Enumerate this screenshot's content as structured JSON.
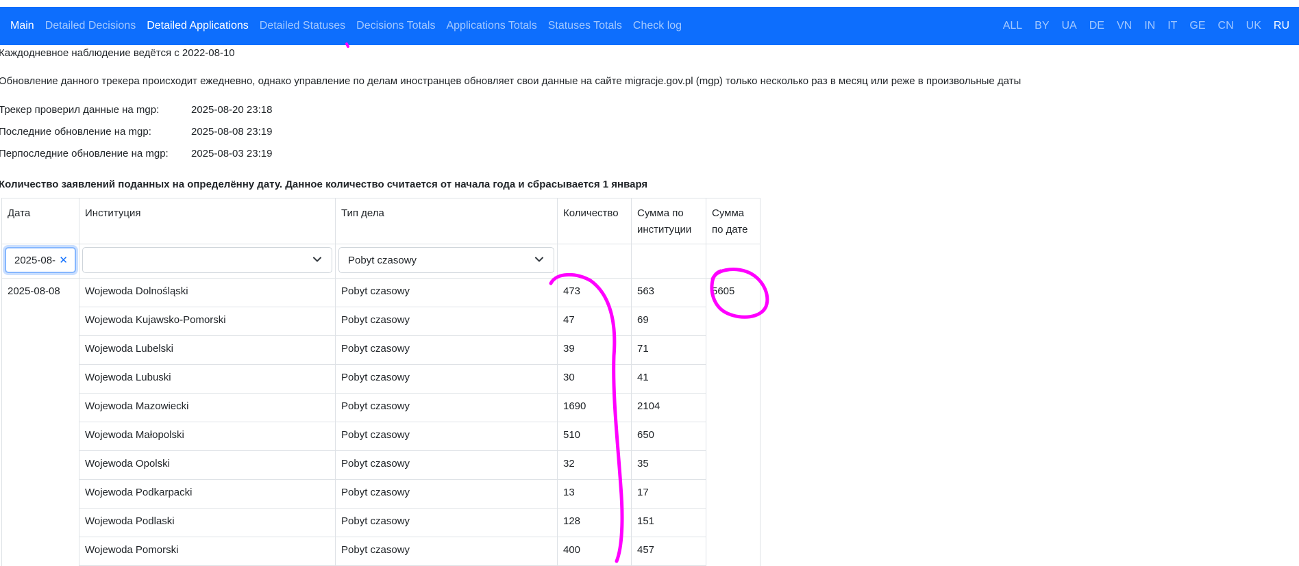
{
  "nav": {
    "left": [
      {
        "label": "Main",
        "active": true
      },
      {
        "label": "Detailed Decisions",
        "active": false
      },
      {
        "label": "Detailed Applications",
        "active": true
      },
      {
        "label": "Detailed Statuses",
        "active": false
      },
      {
        "label": "Decisions Totals",
        "active": false
      },
      {
        "label": "Applications Totals",
        "active": false
      },
      {
        "label": "Statuses Totals",
        "active": false
      },
      {
        "label": "Check log",
        "active": false
      }
    ],
    "langs": [
      "ALL",
      "BY",
      "UA",
      "DE",
      "VN",
      "IN",
      "IT",
      "GE",
      "CN",
      "UK",
      "RU"
    ],
    "active_lang": "RU"
  },
  "intro": {
    "since": "Каждодневное наблюдение ведётся с 2022-08-10",
    "note": "Обновление данного трекера происходит ежедневно, однако управление по делам иностранцев обновляет свои данные на сайте migracje.gov.pl (mgp) только несколько раз в месяц или реже в произвольные даты"
  },
  "info": [
    {
      "label": "Трекер проверил данные на mgp:",
      "value": "2025-08-20 23:18"
    },
    {
      "label": "Последние обновление на mgp:",
      "value": "2025-08-08 23:19"
    },
    {
      "label": "Перпоследние обновление на mgp:",
      "value": "2025-08-03 23:19"
    }
  ],
  "table_title": "Количество заявлений поданных на определённу дату. Данное количество считается от начала года и сбрасывается 1 января",
  "table": {
    "headers": [
      "Дата",
      "Институция",
      "Тип дела",
      "Количество",
      "Сумма по институции",
      "Сумма по дате"
    ],
    "header_lines": {
      "h4": [
        "Сумма по",
        "институции"
      ],
      "h5": [
        "Сумма",
        "по дате"
      ]
    },
    "filters": {
      "date_value": "2025-08-",
      "institution_value": "",
      "case_type_value": "Pobyt czasowy"
    },
    "date": "2025-08-08",
    "date_total": "5605",
    "rows": [
      {
        "institution": "Wojewoda Dolnośląski",
        "type": "Pobyt czasowy",
        "count": "473",
        "sum": "563"
      },
      {
        "institution": "Wojewoda Kujawsko-Pomorski",
        "type": "Pobyt czasowy",
        "count": "47",
        "sum": "69"
      },
      {
        "institution": "Wojewoda Lubelski",
        "type": "Pobyt czasowy",
        "count": "39",
        "sum": "71"
      },
      {
        "institution": "Wojewoda Lubuski",
        "type": "Pobyt czasowy",
        "count": "30",
        "sum": "41"
      },
      {
        "institution": "Wojewoda Mazowiecki",
        "type": "Pobyt czasowy",
        "count": "1690",
        "sum": "2104"
      },
      {
        "institution": "Wojewoda Małopolski",
        "type": "Pobyt czasowy",
        "count": "510",
        "sum": "650"
      },
      {
        "institution": "Wojewoda Opolski",
        "type": "Pobyt czasowy",
        "count": "32",
        "sum": "35"
      },
      {
        "institution": "Wojewoda Podkarpacki",
        "type": "Pobyt czasowy",
        "count": "13",
        "sum": "17"
      },
      {
        "institution": "Wojewoda Podlaski",
        "type": "Pobyt czasowy",
        "count": "128",
        "sum": "151"
      },
      {
        "institution": "Wojewoda Pomorski",
        "type": "Pobyt czasowy",
        "count": "400",
        "sum": "457"
      }
    ]
  },
  "colors": {
    "navbar": "#0d6efd",
    "annotation": "#ff00ff"
  }
}
